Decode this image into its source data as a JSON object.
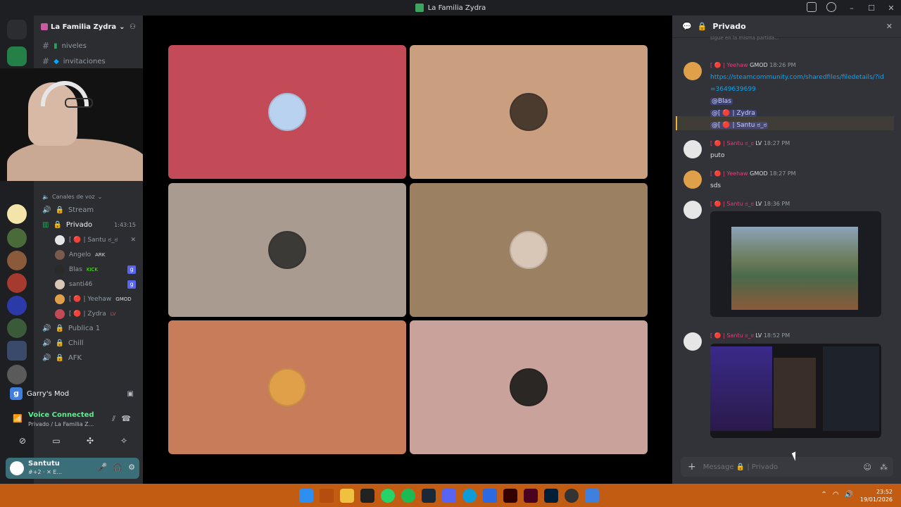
{
  "window": {
    "title": "La Familia Zydra"
  },
  "guild": {
    "name": "La Familia Zydra"
  },
  "text_channels": [
    {
      "name": "niveles"
    },
    {
      "name": "invitaciones"
    }
  ],
  "voice_category": "Canales de voz",
  "voice_channels": {
    "stream": "Stream",
    "privado": "Privado",
    "privado_time": "1:43:15",
    "publica": "Publica 1",
    "chill": "Chill",
    "afk": "AFK"
  },
  "voice_users": [
    {
      "name": "[ 🔴 | Santu ಠ_ಠ",
      "tag": ""
    },
    {
      "name": "Angelo",
      "tag": "ARK"
    },
    {
      "name": "Blas",
      "tag": "KICK"
    },
    {
      "name": "santi46",
      "tag": ""
    },
    {
      "name": "[ 🔴 | Yeehaw",
      "tag": "GMOD"
    },
    {
      "name": "[ 🔴 | Zydra",
      "tag": "LV"
    }
  ],
  "activity": {
    "name": "Garry's Mod"
  },
  "voice_status": {
    "title": "Voice Connected",
    "subtitle": "Privado / La Familia Z..."
  },
  "user": {
    "name": "Santutu",
    "status": "#+2 · ✕ E..."
  },
  "chat": {
    "channel": "Privado",
    "top_snippet": "sigue en la misma partida...",
    "placeholder": "Message 🔒 | Privado",
    "messages": [
      {
        "user": "[ 🔴 | Yeehaw",
        "badge": "GMOD",
        "time": "18:26 PM",
        "link": "https://steamcommunity.com/sharedfiles/filedetails/?id=3649639699",
        "mentions": [
          "@Blas",
          "@[ 🔴 | Zydra",
          "@[ 🔴 | Santu ಠ_ಠ"
        ]
      },
      {
        "user": "[ 🔴 | Santu ಠ_ಠ",
        "badge": "LV",
        "time": "18:27 PM",
        "text": "puto"
      },
      {
        "user": "[ 🔴 | Yeehaw",
        "badge": "GMOD",
        "time": "18:27 PM",
        "text": "sds"
      },
      {
        "user": "[ 🔴 | Santu ಠ_ಠ",
        "badge": "LV",
        "time": "18:36 PM"
      },
      {
        "user": "[ 🔴 | Santu ಠ_ಠ",
        "badge": "LV",
        "time": "18:52 PM"
      }
    ]
  },
  "tiles": [
    {
      "color": "#c34a57",
      "avatar": "#b9d2ef"
    },
    {
      "color": "#c99f7f",
      "avatar": "#4b3a2e"
    },
    {
      "color": "#aa9b91",
      "avatar": "#3c3a37"
    },
    {
      "color": "#9c8062",
      "avatar": "#d8c6b6"
    },
    {
      "color": "#c77c5a",
      "avatar": "#e0a04a"
    },
    {
      "color": "#c9a39b",
      "avatar": "#2b2725"
    }
  ],
  "clock": {
    "time": "23:52",
    "date": "19/01/2026"
  }
}
